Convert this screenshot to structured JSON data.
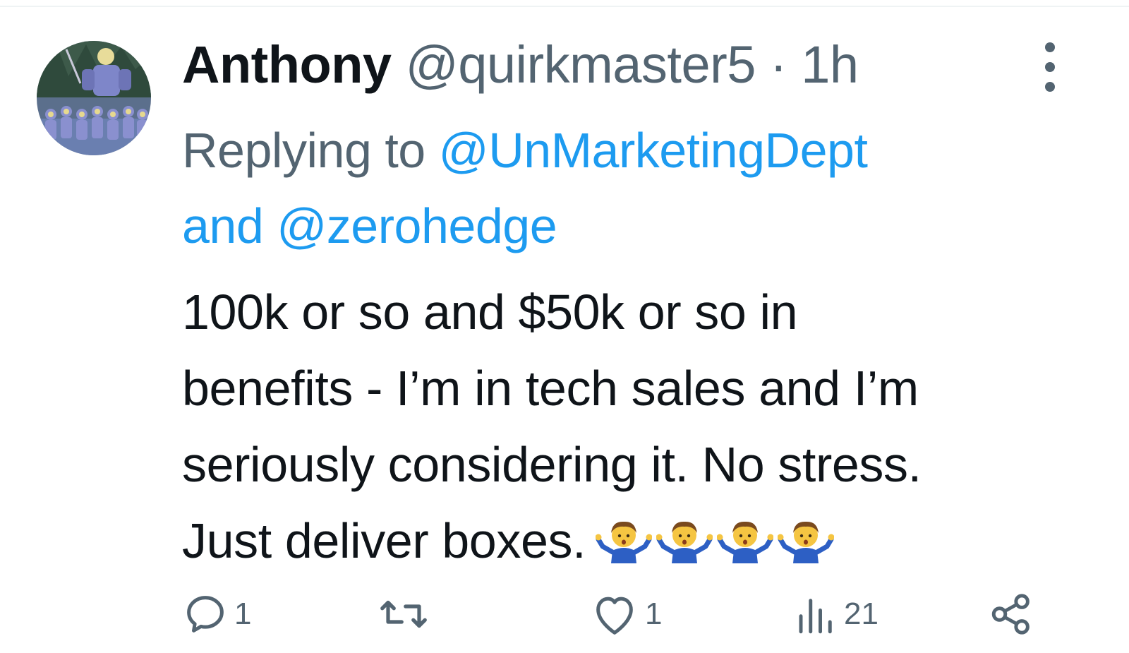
{
  "tweet": {
    "author": {
      "display_name": "Anthony",
      "handle": "@quirkmaster5",
      "separator": "·",
      "time": "1h"
    },
    "reply": {
      "prefix": "Replying to ",
      "mention_1": "@UnMarketingDept",
      "joiner": "and ",
      "mention_2": "@zerohedge"
    },
    "text": {
      "line_1": "100k or so and $50k or so in",
      "line_2": "benefits - I’m in tech sales and I’m",
      "line_3": "seriously considering it. No stress.",
      "line_4": "Just deliver boxes."
    },
    "emojis": [
      "man-shrugging",
      "man-shrugging",
      "man-shrugging",
      "man-shrugging"
    ],
    "actions": {
      "replies": "1",
      "retweets": "",
      "likes": "1",
      "views": "21"
    },
    "icons": {
      "reply": "reply-icon",
      "retweet": "retweet-icon",
      "like": "heart-icon",
      "views": "views-icon",
      "share": "share-icon",
      "more": "more-icon"
    },
    "colors": {
      "text": "#0f1419",
      "secondary": "#536471",
      "mention": "#1d9bf0"
    }
  }
}
